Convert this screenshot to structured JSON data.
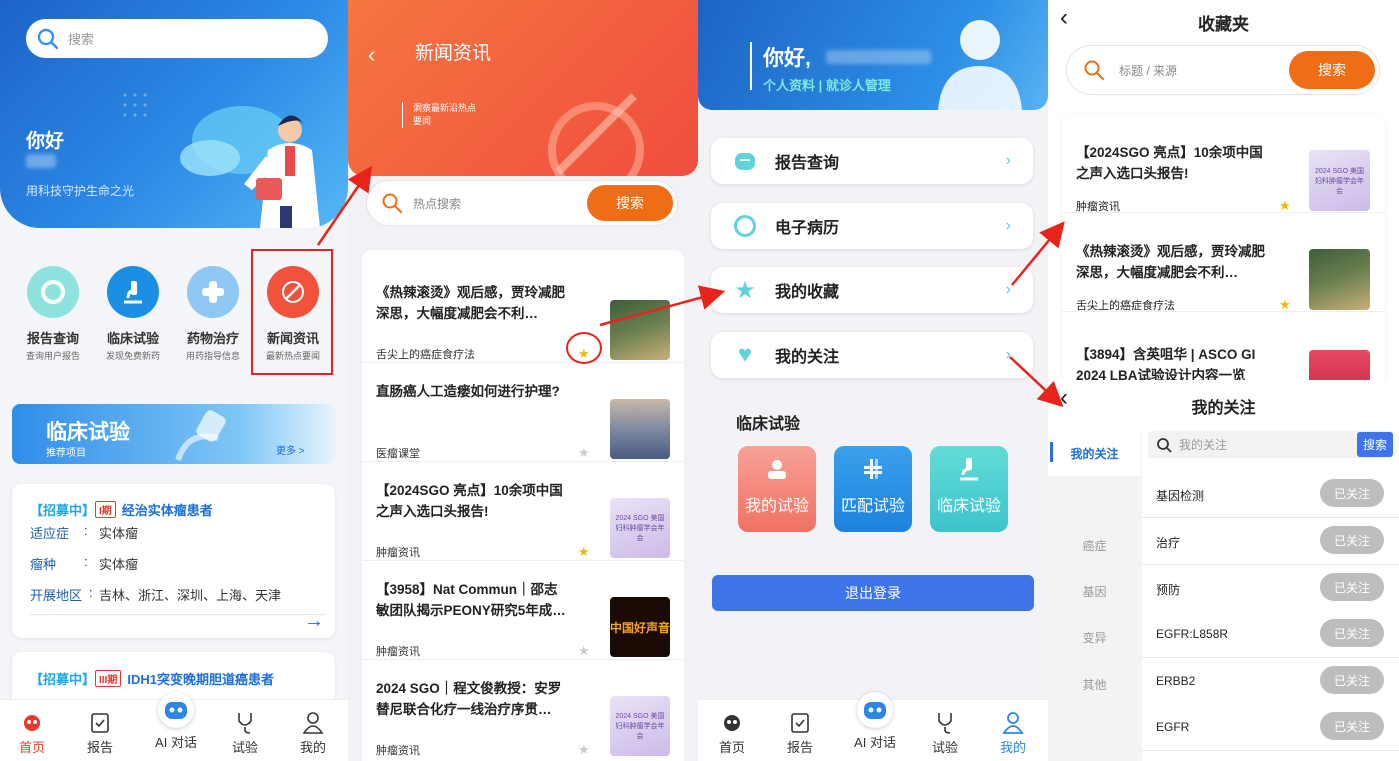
{
  "panel1": {
    "search_placeholder": "搜索",
    "greeting": "你好",
    "slogan": "用科技守护生命之光",
    "icons": [
      {
        "label": "报告查询",
        "sub": "查询用户报告"
      },
      {
        "label": "临床试验",
        "sub": "发现免费新药"
      },
      {
        "label": "药物治疗",
        "sub": "用药指导信息"
      },
      {
        "label": "新闻资讯",
        "sub": "最新热点要闻"
      }
    ],
    "banner": {
      "title": "临床试验",
      "sub": "推荐项目",
      "more": "更多 >"
    },
    "trial1": {
      "status": "【招募中】",
      "phase": "I期",
      "name": "经治实体瘤患者",
      "rows": [
        {
          "k": "适应症",
          "v": "实体瘤"
        },
        {
          "k": "瘤种",
          "v": "实体瘤"
        },
        {
          "k": "开展地区",
          "v": "吉林、浙江、深圳、上海、天津"
        }
      ],
      "arrow": "→"
    },
    "trial2": {
      "status": "【招募中】",
      "phase": "III期",
      "name": "IDH1突变晚期胆道癌患者"
    },
    "tabs": [
      "首页",
      "报告",
      "AI 对话",
      "试验",
      "我的"
    ]
  },
  "panel2": {
    "title": "新闻资讯",
    "hero_line1": "洞察最新沿热点",
    "hero_line2": "要闻",
    "search_placeholder": "热点搜索",
    "search_btn": "搜索",
    "news": [
      {
        "title": "《热辣滚烫》观后感，贾玲减肥深思，大幅度减肥会不利…",
        "source": "舌尖上的癌症食疗法",
        "starred": true
      },
      {
        "title": "直肠癌人工造瘘如何进行护理?",
        "source": "医瘤课堂",
        "starred": false
      },
      {
        "title": "【2024SGO 亮点】10余项中国之声入选口头报告!",
        "source": "肿瘤资讯",
        "starred": true
      },
      {
        "title": "【3958】Nat Commun｜邵志敏团队揭示PEONY研究5年成…",
        "source": "肿瘤资讯",
        "starred": false
      },
      {
        "title": "2024 SGO｜程文俊教授：安罗替尼联合化疗一线治疗序贯…",
        "source": "肿瘤资讯",
        "starred": false
      }
    ],
    "thumb_text": "2024 SGO 美国妇科肿瘤学会年会",
    "thumb_text2": "中国好声音"
  },
  "panel3": {
    "greeting": "你好,",
    "sub": "个人资料 | 就诊人管理",
    "menu": [
      "报告查询",
      "电子病历",
      "我的收藏",
      "我的关注"
    ],
    "section": "临床试验",
    "squares": [
      "我的试验",
      "匹配试验",
      "临床试验"
    ],
    "logout": "退出登录",
    "tabs": [
      "首页",
      "报告",
      "AI 对话",
      "试验",
      "我的"
    ]
  },
  "panel4": {
    "title": "收藏夹",
    "search_placeholder": "标题 / 来源",
    "search_btn": "搜索",
    "favorites": [
      {
        "title": "【2024SGO 亮点】10余项中国之声入选口头报告!",
        "source": "肿瘤资讯"
      },
      {
        "title": "《热辣滚烫》观后感，贾玲减肥深思，大幅度减肥会不利…",
        "source": "舌尖上的癌症食疗法"
      },
      {
        "title": "【3894】含英咀华 | ASCO GI 2024 LBA试验设计内容一览",
        "source": ""
      }
    ],
    "follow_title": "我的关注",
    "follow_search_placeholder": "我的关注",
    "follow_search_btn": "搜索",
    "side": [
      "我的关注",
      "癌症",
      "基因",
      "变异",
      "其他"
    ],
    "follows": [
      "基因检测",
      "治疗",
      "预防",
      "EGFR:L858R",
      "ERBB2",
      "EGFR"
    ],
    "followed_label": "已关注"
  },
  "colors": {
    "brand_blue": "#1f6fd6",
    "news_orange": "#f05a3c",
    "accent_cyan": "#4cc6d6",
    "orange_btn": "#ee6d15",
    "arrow_red": "#e8231c"
  }
}
